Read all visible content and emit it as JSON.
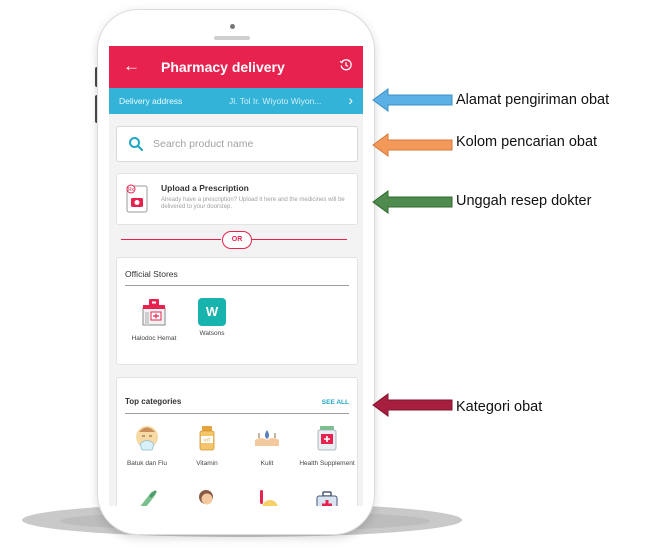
{
  "app": {
    "back_icon": "arrow-left-icon",
    "title": "Pharmacy delivery",
    "history_icon": "history-icon",
    "header_color": "#e8224f"
  },
  "address": {
    "label": "Delivery address",
    "value": "Jl. Tol Ir. Wiyoto Wiyon...",
    "bar_color": "#33b3d8"
  },
  "search": {
    "placeholder": "Search product name",
    "icon": "search-icon"
  },
  "prescription": {
    "title": "Upload a Prescription",
    "description": "Already have a prescription? Upload it here and the medicines will be delivered to your doorstep.",
    "icon": "prescription-upload-icon"
  },
  "divider": {
    "label": "OR"
  },
  "official_stores": {
    "title": "Official Stores",
    "items": [
      {
        "name": "Halodoc Hemat",
        "icon": "halodoc-store-icon"
      },
      {
        "name": "Watsons",
        "icon": "watsons-logo",
        "logo_letter": "W"
      }
    ]
  },
  "top_categories": {
    "title": "Top categories",
    "see_all": "SEE ALL",
    "items": [
      {
        "name": "Batuk dan Flu",
        "icon": "cough-flu-icon"
      },
      {
        "name": "Vitamin",
        "icon": "vitamin-bottle-icon"
      },
      {
        "name": "Kulit",
        "icon": "skin-icon"
      },
      {
        "name": "Health Supplement",
        "icon": "supplement-icon"
      }
    ],
    "partial_row_icons": [
      "thermometer-stick-icon",
      "person-icon",
      "fever-icon",
      "first-aid-kit-icon"
    ]
  },
  "annotations": [
    {
      "text": "Alamat pengiriman obat",
      "color": "#4aa3dc"
    },
    {
      "text": "Kolom pencarian obat",
      "color": "#f08c4a"
    },
    {
      "text": "Unggah resep dokter",
      "color": "#3f7a3f"
    },
    {
      "text": "Kategori obat",
      "color": "#a01c3a"
    }
  ]
}
